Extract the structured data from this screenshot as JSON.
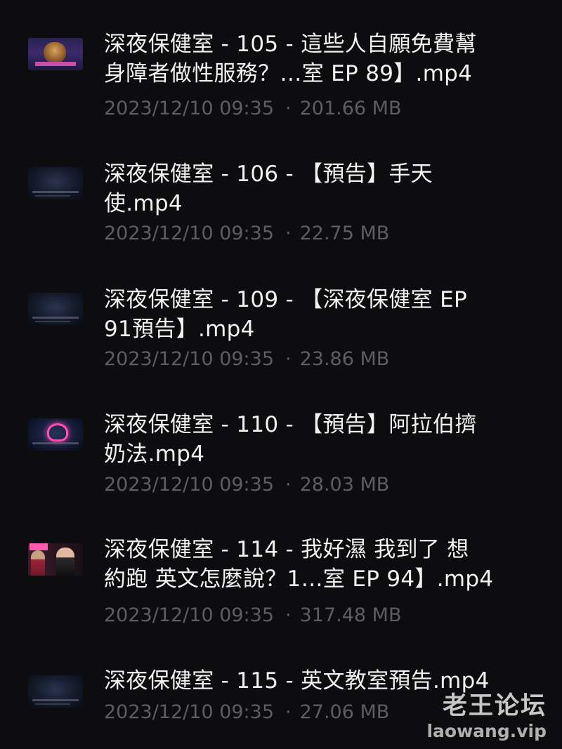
{
  "files": [
    {
      "title": "深夜保健室 - 105 - 這些人自願免費幫\n身障者做性服務？…室 EP  89】.mp4",
      "date": "2023/12/10 09:35",
      "separator": "·",
      "size": "201.66 MB",
      "thumbnail_icon": "video-thumbnail-icon"
    },
    {
      "title": "深夜保健室 - 106 - 【預告】手天\n使.mp4",
      "date": "2023/12/10 09:35",
      "separator": "·",
      "size": "22.75 MB",
      "thumbnail_icon": "video-thumbnail-icon"
    },
    {
      "title": "深夜保健室 - 109 - 【深夜保健室 EP\n91預告】.mp4",
      "date": "2023/12/10 09:35",
      "separator": "·",
      "size": "23.86 MB",
      "thumbnail_icon": "video-thumbnail-icon"
    },
    {
      "title": "深夜保健室 - 110 - 【預告】阿拉伯擠\n奶法.mp4",
      "date": "2023/12/10 09:35",
      "separator": "·",
      "size": "28.03 MB",
      "thumbnail_icon": "video-thumbnail-icon"
    },
    {
      "title": "深夜保健室 - 114 - 我好濕 我到了 想\n約跑 英文怎麼說？1…室 EP 94】.mp4",
      "date": "2023/12/10 09:35",
      "separator": "·",
      "size": "317.48 MB",
      "thumbnail_icon": "video-thumbnail-icon"
    },
    {
      "title": "深夜保健室 - 115 - 英文教室預告.mp4",
      "date": "2023/12/10 09:35",
      "separator": "·",
      "size": "27.06 MB",
      "thumbnail_icon": "video-thumbnail-icon"
    }
  ],
  "watermark": {
    "cn": "老王论坛",
    "en": "laowang.vip"
  },
  "colors": {
    "background": "#0d0d0f",
    "title_text": "#f2f2f2",
    "meta_text": "#5e5e62"
  }
}
